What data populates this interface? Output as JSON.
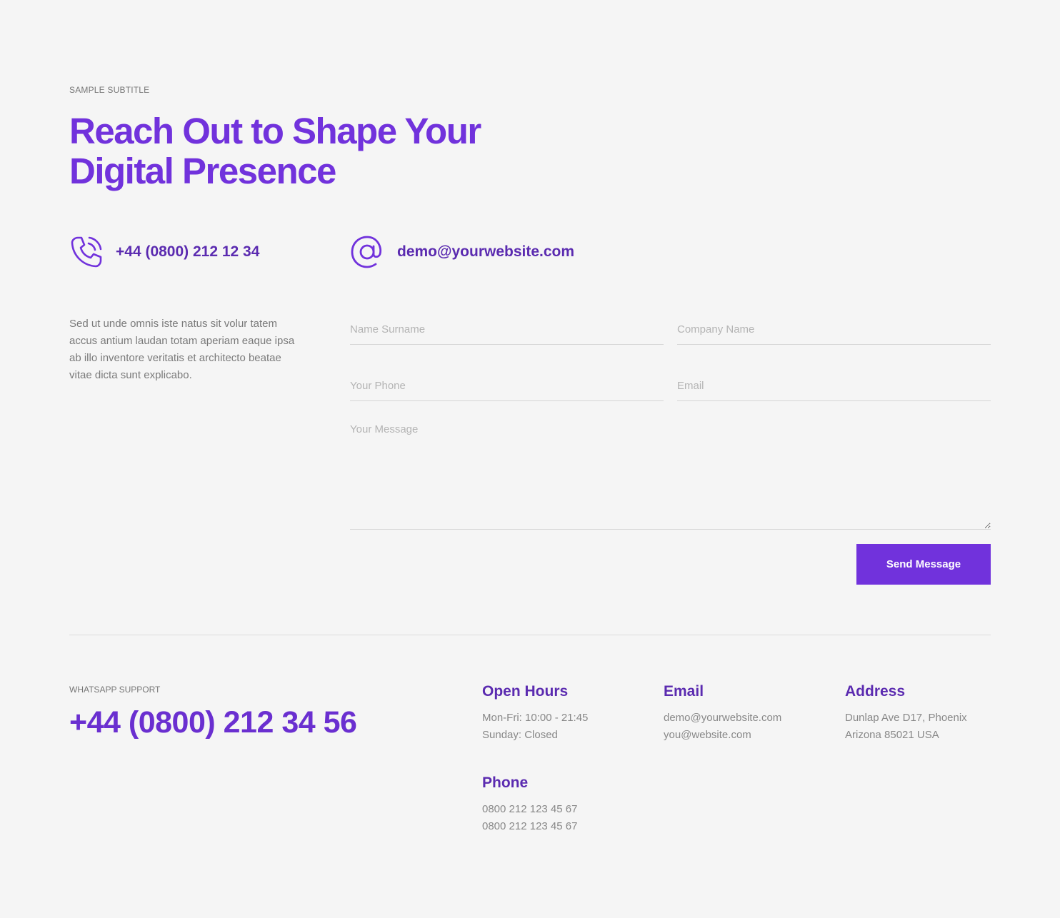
{
  "header": {
    "subtitle": "SAMPLE SUBTITLE",
    "title": "Reach Out to Shape Your Digital Presence"
  },
  "contact": {
    "phone": "+44 (0800) 212 12 34",
    "phone_icon": "phone-ringing-icon",
    "email": "demo@yourwebsite.com",
    "email_icon": "at-sign-icon"
  },
  "intro_text": "Sed ut unde omnis iste natus sit volur tatem accus antium laudan totam aperiam eaque ipsa ab illo inventore veritatis et architecto beatae vitae dicta sunt explicabo.",
  "form": {
    "name_placeholder": "Name Surname",
    "company_placeholder": "Company Name",
    "phone_placeholder": "Your Phone",
    "email_placeholder": "Email",
    "message_placeholder": "Your Message",
    "submit_label": "Send Message"
  },
  "whatsapp": {
    "label": "WHATSAPP SUPPORT",
    "number": "+44 (0800) 212 34 56"
  },
  "info": {
    "hours": {
      "title": "Open Hours",
      "lines": [
        "Mon-Fri: 10:00 - 21:45",
        "Sunday: Closed"
      ]
    },
    "email": {
      "title": "Email",
      "lines": [
        "demo@yourwebsite.com",
        "you@website.com"
      ]
    },
    "address": {
      "title": "Address",
      "lines": [
        "Dunlap Ave D17, Phoenix",
        "Arizona 85021 USA"
      ]
    },
    "phone": {
      "title": "Phone",
      "lines": [
        "0800 212 123 45 67",
        "0800 212 123 45 67"
      ]
    }
  },
  "colors": {
    "accent": "#7132dc",
    "background": "#f5f5f5"
  }
}
